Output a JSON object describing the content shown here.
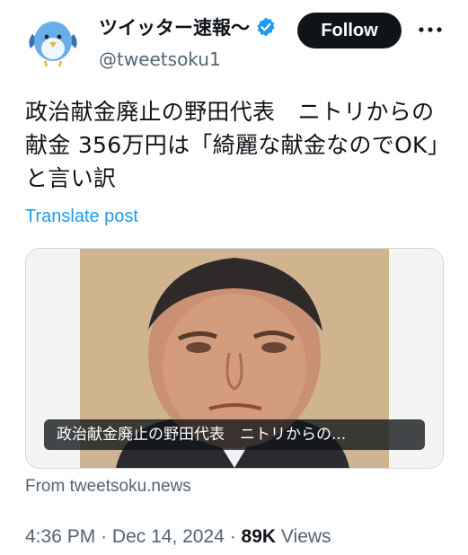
{
  "author": {
    "display_name": "ツイッター速報〜",
    "handle": "@tweetsoku1",
    "avatar_icon": "bird-avatar-icon",
    "verified_icon": "verified-badge-icon"
  },
  "follow_button": {
    "label": "Follow"
  },
  "more_icon": "more-options-icon",
  "tweet": {
    "text": "政治献金廃止の野田代表　ニトリからの献金 356万円は「綺麗な献金なのでOK」と言い訳",
    "translate_label": "Translate post"
  },
  "card": {
    "caption": "政治献金廃止の野田代表　ニトリからの...",
    "source": "From tweetsoku.news"
  },
  "meta": {
    "time": "4:36 PM",
    "separator": "·",
    "date": "Dec 14, 2024",
    "views_count": "89K",
    "views_label": "Views"
  },
  "colors": {
    "accent": "#1d9bf0",
    "secondary_text": "#536471",
    "verified": "#1d9bf0",
    "follow_bg": "#0f1419"
  }
}
